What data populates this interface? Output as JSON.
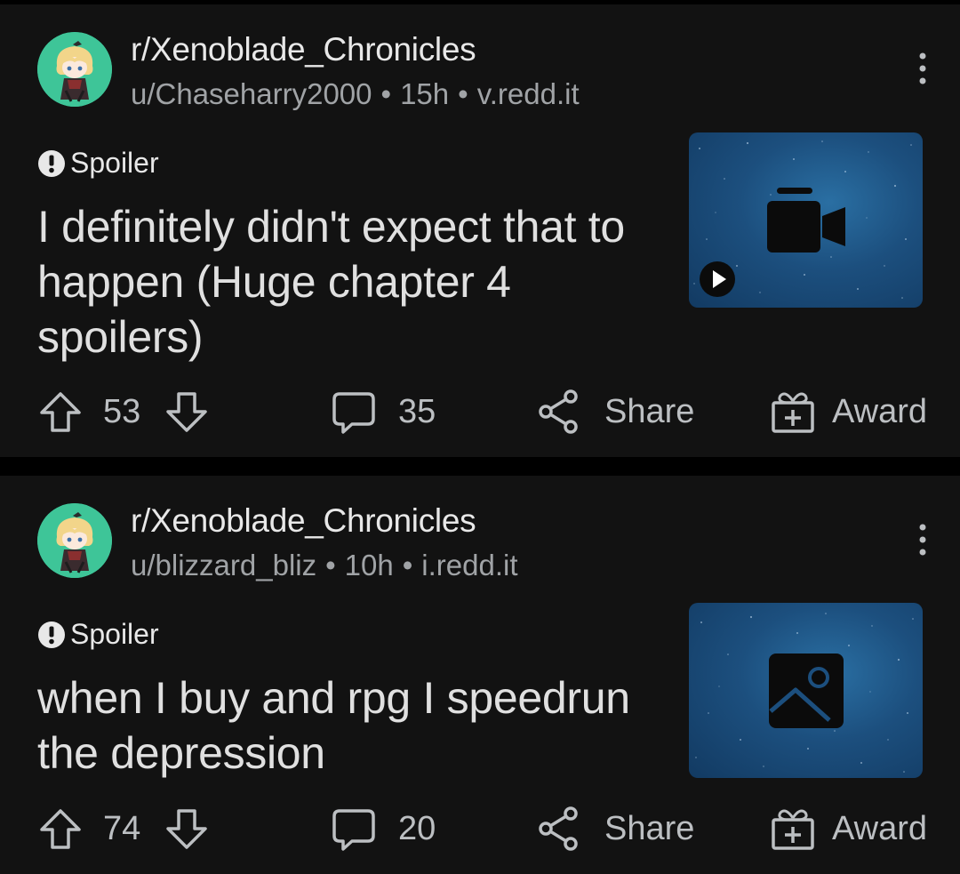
{
  "posts": [
    {
      "subreddit": "r/Xenoblade_Chronicles",
      "author": "u/Chaseharry2000",
      "age": "15h",
      "domain": "v.redd.it",
      "spoiler_label": "Spoiler",
      "title": "I definitely didn't expect that to happen (Huge chapter 4 spoilers)",
      "thumbnail_type": "video-camera-icon",
      "votes": "53",
      "comments": "35",
      "share_label": "Share",
      "award_label": "Award"
    },
    {
      "subreddit": "r/Xenoblade_Chronicles",
      "author": "u/blizzard_bliz",
      "age": "10h",
      "domain": "i.redd.it",
      "spoiler_label": "Spoiler",
      "title": "when I buy and rpg I speedrun the depression",
      "thumbnail_type": "image-icon",
      "votes": "74",
      "comments": "20",
      "share_label": "Share",
      "award_label": "Award"
    }
  ],
  "meta_separator": "•",
  "colors": {
    "background": "#000000",
    "card": "#121212",
    "text_primary": "#e0e0e0",
    "text_secondary": "#a0a3a6",
    "avatar_bg": "#3ec598",
    "thumbnail_bg": "#1c4f7e"
  }
}
